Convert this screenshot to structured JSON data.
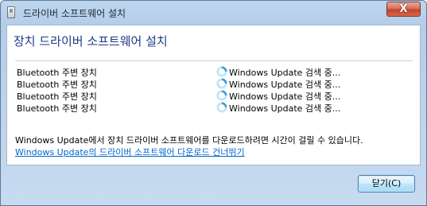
{
  "window": {
    "title": "드라이버 소프트웨어 설치",
    "close_glyph": "X"
  },
  "main": {
    "heading": "장치 드라이버 소프트웨어 설치",
    "devices": [
      {
        "name": "Bluetooth 주변 장치",
        "status": "Windows Update 검색 중..."
      },
      {
        "name": "Bluetooth 주변 장치",
        "status": "Windows Update 검색 중..."
      },
      {
        "name": "Bluetooth 주변 장치",
        "status": "Windows Update 검색 중..."
      },
      {
        "name": "Bluetooth 주변 장치",
        "status": "Windows Update 검색 중..."
      }
    ],
    "info_text": "Windows Update에서 장치 드라이버 소프트웨어를 다운로드하려면 시간이 걸릴 수 있습니다.",
    "skip_link": "Windows Update의 드라이버 소프트웨어 다운로드 건너뛰기"
  },
  "footer": {
    "close_button": "닫기(C)"
  },
  "colors": {
    "heading": "#1e3a8a",
    "link": "#0066cc",
    "spinner": "#3a9fd6"
  },
  "icons": {
    "title": "device-icon",
    "status": "busy-spinner-icon"
  }
}
